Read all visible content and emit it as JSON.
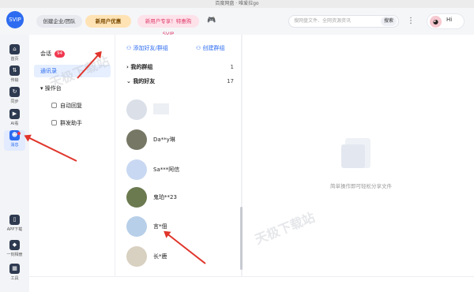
{
  "window": {
    "title": "百度网盘 · 唯爱拉go"
  },
  "header": {
    "logo_text": "SVIP",
    "btn_enterprise": "创建企业/团队",
    "btn_newuser": "新用户优惠",
    "btn_promo": "新用户专享！特惠购SVIP",
    "search_placeholder": "搜网盘文件、全网资源资讯",
    "search_button": "搜索",
    "more": "⋮",
    "greeting": "Hi",
    "game_icon": "gamepad-icon"
  },
  "sidebar": {
    "items": [
      {
        "label": "首页",
        "icon": "home-icon",
        "glyph": "⌂"
      },
      {
        "label": "传输",
        "icon": "transfer-icon",
        "glyph": "⇅"
      },
      {
        "label": "同步",
        "icon": "sync-icon",
        "glyph": "↻"
      },
      {
        "label": "AI看",
        "icon": "ai-icon",
        "glyph": "▶"
      },
      {
        "label": "消息",
        "icon": "message-icon",
        "glyph": "☻"
      }
    ],
    "bottom": [
      {
        "label": "APP下载",
        "icon": "phone-icon",
        "glyph": "▯"
      },
      {
        "label": "一刻相册",
        "icon": "album-icon",
        "glyph": "◆"
      },
      {
        "label": "工具",
        "icon": "tools-icon",
        "glyph": "▦"
      }
    ]
  },
  "panel1": {
    "chat_label": "会话",
    "chat_badge": "94",
    "contacts_label": "通讯录",
    "workbench_label": "操作台",
    "auto_reply": "自动回复",
    "group_assistant": "群发助手"
  },
  "panel2": {
    "add_friend": "添加好友/群组",
    "create_group": "创建群组",
    "my_groups": "我的群组",
    "my_groups_count": "1",
    "my_friends": "我的好友",
    "my_friends_count": "17",
    "friends": [
      {
        "name": ""
      },
      {
        "name": "Da**y琳"
      },
      {
        "name": "Sa***阿信"
      },
      {
        "name": "鬼珀**23"
      },
      {
        "name": "言*佃"
      },
      {
        "name": "长*鹿"
      }
    ]
  },
  "main": {
    "empty_text": "简单操作即可轻松分享文件"
  },
  "watermark": "天极下载站",
  "colors": {
    "accent": "#2d6cf0",
    "annotation": "#e0352b",
    "badge": "#f0384f"
  }
}
